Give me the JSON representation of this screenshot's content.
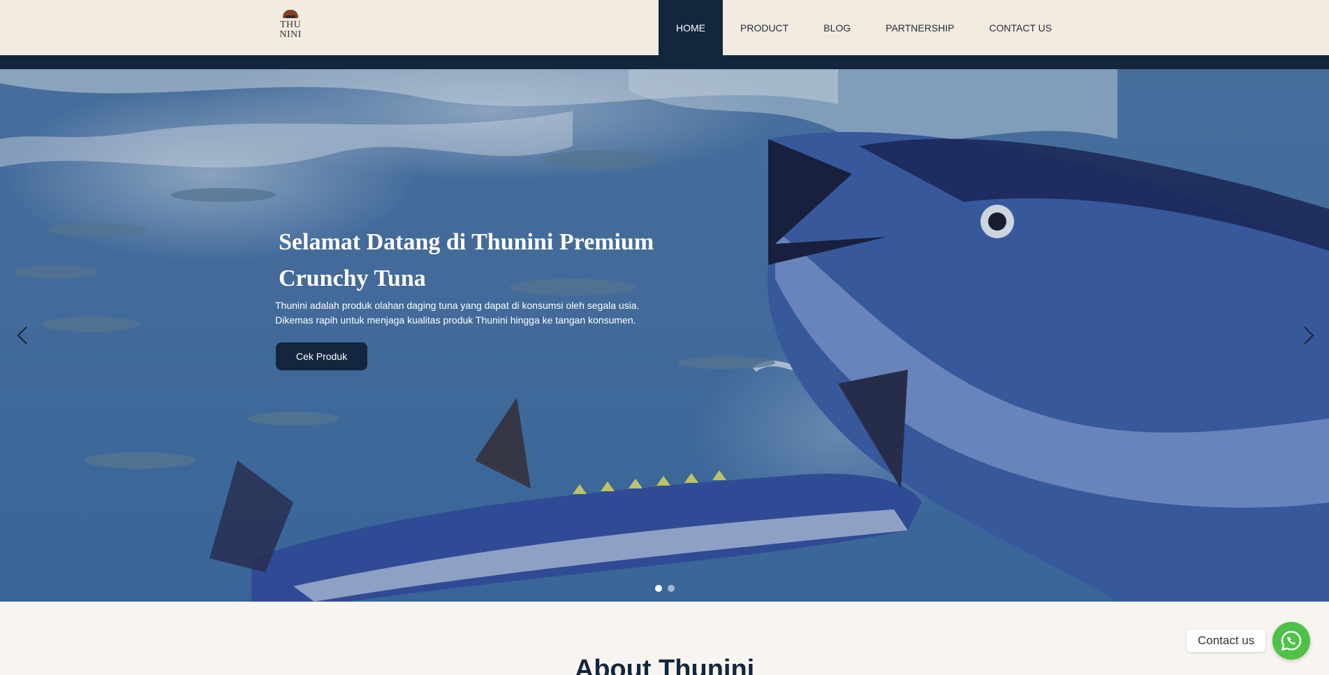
{
  "header": {
    "logo_text_line1": "THU",
    "logo_text_line2": "NINI",
    "nav": [
      {
        "label": "HOME",
        "active": true
      },
      {
        "label": "PRODUCT",
        "active": false
      },
      {
        "label": "BLOG",
        "active": false
      },
      {
        "label": "PARTNERSHIP",
        "active": false
      },
      {
        "label": "CONTACT US",
        "active": false
      }
    ]
  },
  "hero": {
    "title_line1": "Selamat Datang di Thunini Premium",
    "title_line2": "Crunchy Tuna",
    "desc_line1": "Thunini adalah produk olahan daging tuna yang dapat di konsumsi oleh segala usia.",
    "desc_line2": "Dikemas rapih untuk menjaga kualitas produk Thunini hingga ke tangan konsumen.",
    "cta_label": "Cek Produk",
    "slides_count": 2,
    "active_slide": 1
  },
  "about": {
    "title": "About Thunini"
  },
  "floating_contact": {
    "label": "Contact us",
    "icon": "whatsapp-icon"
  },
  "colors": {
    "navy": "#14263d",
    "header_bg": "#f2ebe0",
    "whatsapp_green": "#4dc247"
  }
}
